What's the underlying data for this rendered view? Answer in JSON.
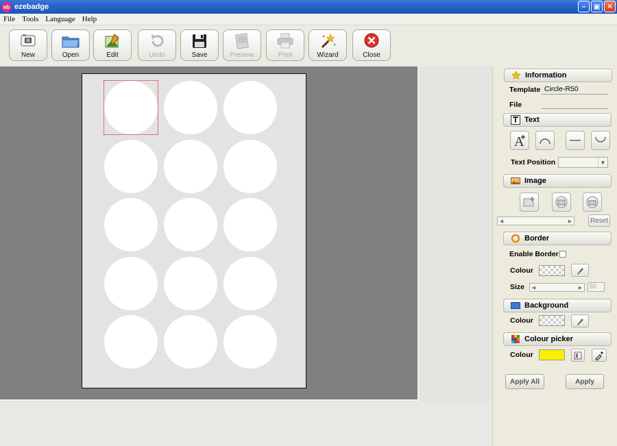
{
  "window": {
    "title": "ezebadge",
    "logo_text": "eb",
    "minimize": "–",
    "restore": "▣",
    "close": "✕"
  },
  "menu": [
    "File",
    "Tools",
    "Language",
    "Help"
  ],
  "toolbar": {
    "new": "New",
    "open": "Open",
    "edit": "Edit",
    "undo": "Undo",
    "save": "Save",
    "preview": "Preview",
    "print": "Print",
    "wizard": "Wizard",
    "close": "Close"
  },
  "sheet": {
    "rows": 5,
    "cols": 3
  },
  "panel": {
    "information": {
      "header": "Information",
      "template_label": "Template",
      "template_value": "Circle-R50",
      "file_label": "File",
      "file_value": ""
    },
    "text": {
      "header": "Text",
      "text_position_label": "Text Position",
      "text_position_value": ""
    },
    "image": {
      "header": "Image",
      "reset_label": "Reset"
    },
    "border": {
      "header": "Border",
      "enable_label": "Enable Border",
      "colour_label": "Colour",
      "size_label": "Size",
      "size_value": "50"
    },
    "background": {
      "header": "Background",
      "colour_label": "Colour"
    },
    "colour_picker": {
      "header": "Colour picker",
      "colour_label": "Colour",
      "colour_value": "#f8f000"
    },
    "apply_all_label": "Apply All",
    "apply_label": "Apply"
  },
  "colors": {
    "titlebar": "#2862c8",
    "canvas_bg": "#808080",
    "sheet_bg": "#e3e3e3",
    "selection": "#e00000",
    "picker_colour": "#f8f000"
  }
}
